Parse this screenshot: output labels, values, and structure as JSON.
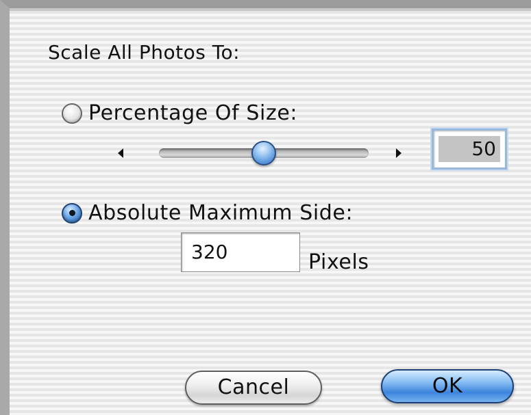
{
  "dialog": {
    "heading": "Scale All Photos To:"
  },
  "percentage_option": {
    "label": "Percentage Of Size:",
    "selected": false,
    "slider_value_fraction": 0.5,
    "value": "50"
  },
  "absolute_option": {
    "label": "Absolute Maximum Side:",
    "selected": true,
    "value": "320",
    "unit_label": "Pixels"
  },
  "buttons": {
    "cancel_label": "Cancel",
    "ok_label": "OK"
  },
  "colors": {
    "accent": "#3c84dc",
    "focus_ring": "#98b8dc"
  }
}
